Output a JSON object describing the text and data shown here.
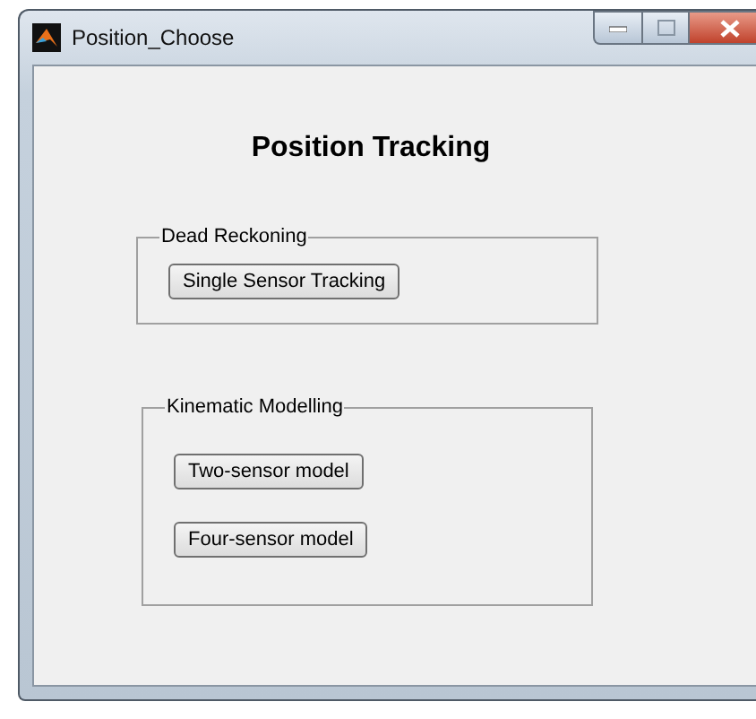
{
  "window": {
    "title": "Position_Choose"
  },
  "heading": "Position Tracking",
  "panels": [
    {
      "title": "Dead Reckoning",
      "buttons": [
        "Single Sensor Tracking"
      ]
    },
    {
      "title": "Kinematic Modelling",
      "buttons": [
        "Two-sensor model",
        "Four-sensor model"
      ]
    }
  ]
}
